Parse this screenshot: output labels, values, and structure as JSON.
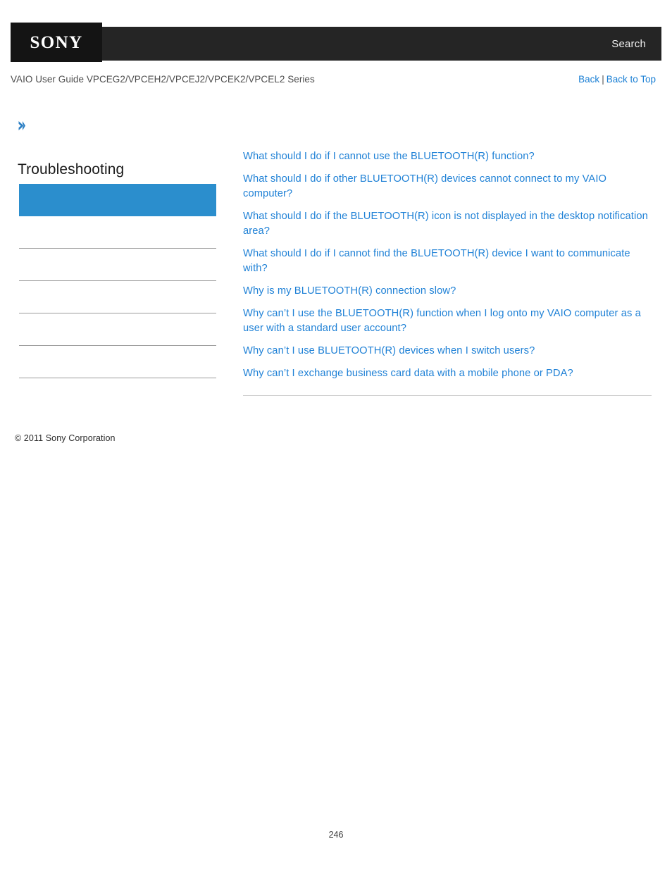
{
  "header": {
    "logo_text": "SONY",
    "search_label": "Search"
  },
  "subheader": {
    "guide_title": "VAIO User Guide VPCEG2/VPCEH2/VPCEJ2/VPCEK2/VPCEL2 Series",
    "back_label": "Back",
    "separator": "|",
    "back_to_top_label": "Back to Top"
  },
  "sidebar": {
    "breadcrumb_icon": "chevron-right-icon",
    "title": "Troubleshooting",
    "highlight_color": "#2b8ecd",
    "rule_count": 5,
    "copyright": "© 2011 Sony Corporation"
  },
  "content": {
    "links": [
      {
        "label": "What should I do if I cannot use the BLUETOOTH(R) function?"
      },
      {
        "label": "What should I do if other BLUETOOTH(R) devices cannot connect to my VAIO computer?"
      },
      {
        "label": "What should I do if the BLUETOOTH(R) icon is not displayed in the desktop notification area?"
      },
      {
        "label": "What should I do if I cannot find the BLUETOOTH(R) device I want to communicate with?"
      },
      {
        "label": "Why is my BLUETOOTH(R) connection slow?"
      },
      {
        "label": "Why can’t I use the BLUETOOTH(R) function when I log onto my VAIO computer as a user with a standard user account?"
      },
      {
        "label": "Why can’t I use BLUETOOTH(R) devices when I switch users?"
      },
      {
        "label": "Why can’t I exchange business card data with a mobile phone or PDA?"
      }
    ]
  },
  "footer": {
    "page_number": "246"
  },
  "colors": {
    "link_blue": "#1f81d6",
    "nav_blue": "#1a7fd4",
    "highlight_blue": "#2b8ecd",
    "bar_black": "#252525",
    "logo_box_black": "#141414"
  }
}
